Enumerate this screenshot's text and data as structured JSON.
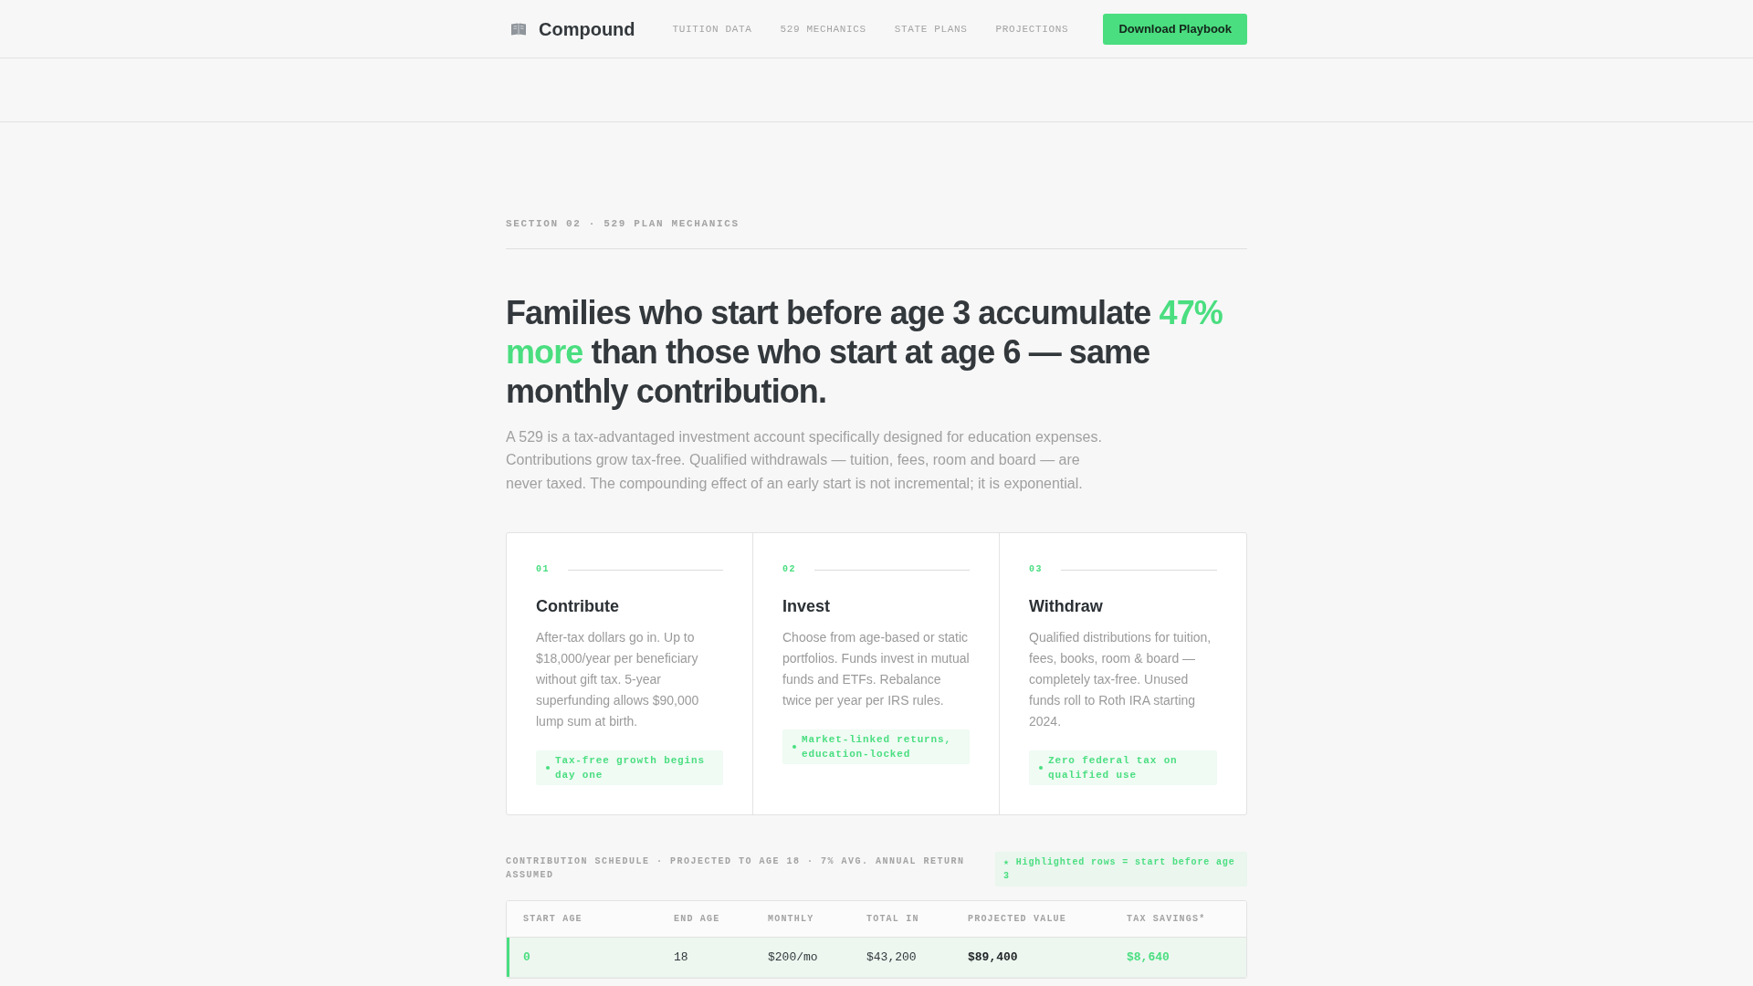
{
  "header": {
    "brand": "Compound",
    "nav": [
      "TUITION DATA",
      "529 MECHANICS",
      "STATE PLANS",
      "PROJECTIONS"
    ],
    "cta": "Download Playbook"
  },
  "section": {
    "label": "SECTION 02 · 529 PLAN MECHANICS",
    "headline": [
      {
        "text": "Families who start before age 3 accumulate ",
        "accent": false
      },
      {
        "text": "47% more",
        "accent": true
      },
      {
        "text": " than those who start at age 6 — same monthly contribution.",
        "accent": false
      }
    ],
    "intro": "A 529 is a tax-advantaged investment account specifically designed for education expenses. Contributions grow tax-free. Qualified withdrawals — tuition, fees, room and board — are never taxed. The compounding effect of an early start is not incremental; it is exponential."
  },
  "steps": [
    {
      "number": "01",
      "title": "Contribute",
      "description": "After-tax dollars go in. Up to $18,000/year per beneficiary without gift tax. 5-year superfunding allows $90,000 lump sum at birth.",
      "tag": "Tax-free growth begins day one"
    },
    {
      "number": "02",
      "title": "Invest",
      "description": "Choose from age-based or static portfolios. Funds invest in mutual funds and ETFs. Rebalance twice per year per IRS rules.",
      "tag": "Market-linked returns, education-locked"
    },
    {
      "number": "03",
      "title": "Withdraw",
      "description": "Qualified distributions for tuition, fees, books, room & board — completely tax-free. Unused funds roll to Roth IRA starting 2024.",
      "tag": "Zero federal tax on qualified use"
    }
  ],
  "schedule": {
    "caption": "CONTRIBUTION SCHEDULE · PROJECTED TO AGE 18 · 7% AVG. ANNUAL RETURN ASSUMED",
    "legend": "★ Highlighted rows = start before age 3",
    "columns": [
      {
        "label": "START AGE",
        "kind": "accent"
      },
      {
        "label": "END AGE",
        "kind": "plain"
      },
      {
        "label": "MONTHLY",
        "kind": "plain"
      },
      {
        "label": "TOTAL IN",
        "kind": "plain"
      },
      {
        "label": "PROJECTED VALUE",
        "kind": "strong"
      },
      {
        "label": "TAX SAVINGS*",
        "kind": "accent"
      }
    ],
    "rows": [
      {
        "highlighted": true,
        "cells": [
          "0",
          "18",
          "$200/mo",
          "$43,200",
          "$89,400",
          "$8,640"
        ]
      }
    ]
  }
}
